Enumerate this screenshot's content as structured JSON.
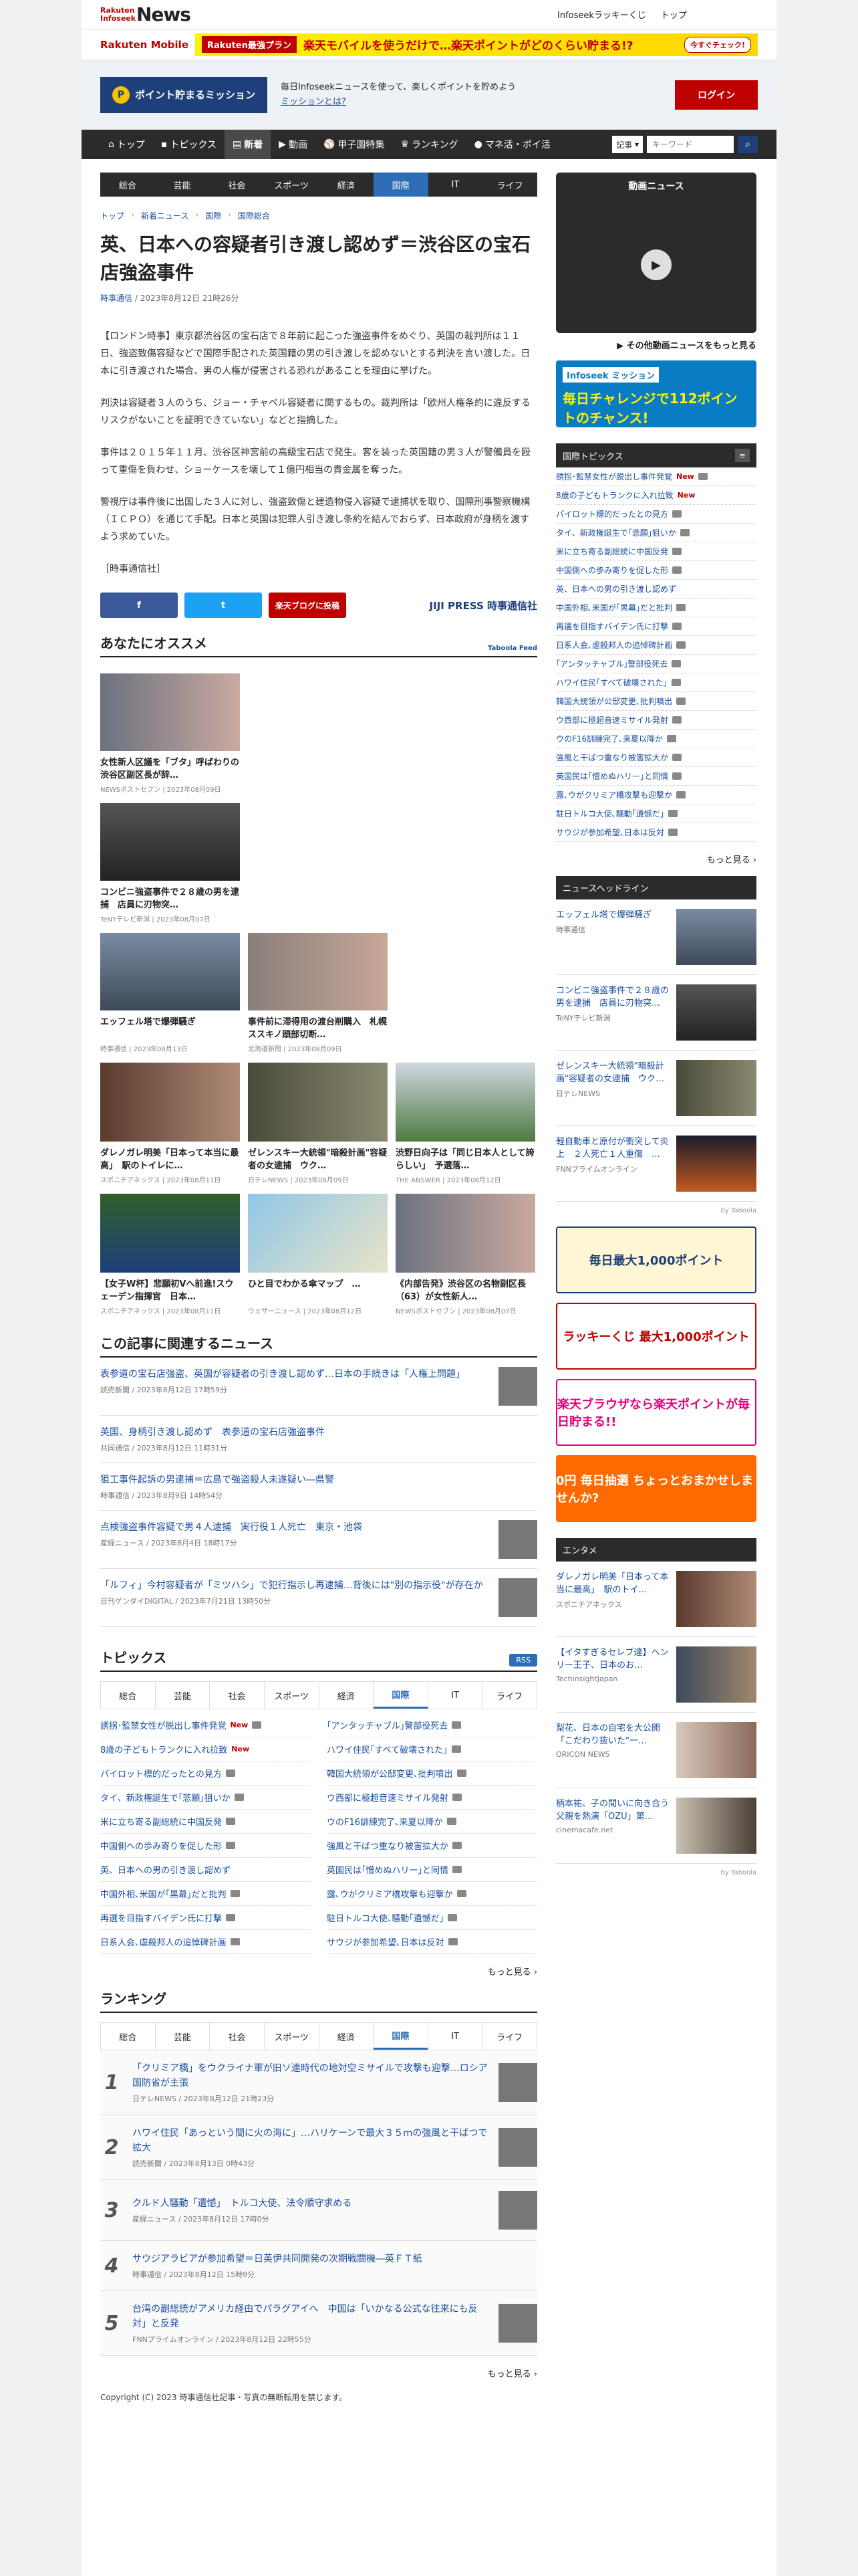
{
  "header": {
    "logo_top": "Rakuten Infoseek",
    "logo_main": "News",
    "kuji": "Infoseekラッキーくじ",
    "top_link": "トップ"
  },
  "promo": {
    "rakuten_mobile": "Rakuten Mobile",
    "plan": "Rakuten最強プラン",
    "text": "楽天モバイルを使うだけで…楽天ポイントがどのくらい貯まる!?",
    "btn": "今すぐチェック!"
  },
  "mission": {
    "label": "ポイント貯まるミッション",
    "desc": "毎日Infoseekニュースを使って、楽しくポイントを貯めよう",
    "link": "ミッションとは?",
    "login": "ログイン"
  },
  "nav": {
    "items": [
      "トップ",
      "トピックス",
      "新着",
      "動画",
      "甲子園特集",
      "ランキング",
      "マネ活・ポイ活"
    ],
    "search_select": "記事",
    "search_placeholder": "キーワード"
  },
  "subnav": [
    "総合",
    "芸能",
    "社会",
    "スポーツ",
    "経済",
    "国際",
    "IT",
    "ライフ"
  ],
  "breadcrumb": [
    "トップ",
    "新着ニュース",
    "国際",
    "国際総合"
  ],
  "article": {
    "title": "英、日本への容疑者引き渡し認めず＝渋谷区の宝石店強盗事件",
    "source": "時事通信",
    "date": "2023年8月12日 21時26分",
    "paragraphs": [
      "【ロンドン時事】東京都渋谷区の宝石店で８年前に起こった強盗事件をめぐり、英国の裁判所は１１日、強盗致傷容疑などで国際手配された英国籍の男の引き渡しを認めないとする判決を言い渡した。日本に引き渡された場合、男の人権が侵害される恐れがあることを理由に挙げた。",
      "判決は容疑者３人のうち、ジョー・チャペル容疑者に関するもの。裁判所は「欧州人権条約に違反するリスクがないことを証明できていない」などと指摘した。",
      "事件は２０１５年１１月、渋谷区神宮前の高級宝石店で発生。客を装った英国籍の男３人が警備員を殴って重傷を負わせ、ショーケースを壊して１億円相当の貴金属を奪った。",
      "警視庁は事件後に出国した３人に対し、強盗致傷と建造物侵入容疑で逮捕状を取り、国際刑事警察機構（ＩＣＰＯ）を通じて手配。日本と英国は犯罪人引き渡し条約を結んでおらず、日本政府が身柄を渡すよう求めていた。",
      "［時事通信社］"
    ],
    "share_fb": "f",
    "share_tw": "t",
    "share_blog": "楽天ブログに投稿",
    "jiji": "JIJI PRESS 時事通信社"
  },
  "recommend": {
    "title": "あなたにオススメ",
    "tag": "Taboola Feed",
    "items": [
      {
        "t": "女性新人区議を「ブタ」呼ばわりの渋谷区副区長が辞…",
        "s": "NEWSポストセブン | 2023年08月09日"
      },
      {
        "t": "コンビニ強盗事件で２８歳の男を逮捕　店員に刃物突…",
        "s": "TeNYテレビ新潟 | 2023年08月07日"
      },
      {
        "t": "エッフェル塔で爆弾騒ぎ",
        "s": "時事通信 | 2023年08月13日"
      },
      {
        "t": "事件前に滞得用の渡台削購入　札幌ススキノ頭部切断…",
        "s": "北海道新聞 | 2023年08月09日"
      },
      {
        "t": "ダレノガレ明美「日本って本当に最高」　駅のトイレに…",
        "s": "スポニチアネックス | 2023年08月11日"
      },
      {
        "t": "ゼレンスキー大統領\"暗殺計画\"容疑者の女逮捕　ウク…",
        "s": "日テレNEWS | 2023年08月09日"
      },
      {
        "t": "渋野日向子は「同じ日本人として誇らしい」　予選落…",
        "s": "THE ANSWER | 2023年08月12日"
      },
      {
        "t": "【女子W杯】悲願初Vへ前進!スウェーデン指揮官　日本…",
        "s": "スポニチアネックス | 2023年08月11日"
      },
      {
        "t": "ひと目でわかる傘マップ　…",
        "s": "ウェザーニュース | 2023年08月12日"
      },
      {
        "t": "《内部告発》渋谷区の名物副区長（63）が女性新人…",
        "s": "NEWSポストセブン | 2023年08月07日"
      }
    ]
  },
  "related": {
    "title": "この記事に関連するニュース",
    "items": [
      {
        "t": "表参道の宝石店強盗、英国が容疑者の引き渡し認めず…日本の手続きは「人権上問題」",
        "s": "読売新聞 / 2023年8月12日 17時59分"
      },
      {
        "t": "英国、身柄引き渡し認めず　表参道の宝石店強盗事件",
        "s": "共同通信 / 2023年8月12日 11時31分"
      },
      {
        "t": "狙工事件起訴の男逮捕＝広島で強盗殺人未遂疑い―県警",
        "s": "時事通信 / 2023年8月9日 14時54分"
      },
      {
        "t": "点検強盗事件容疑で男４人逮捕　実行役１人死亡　東京・池袋",
        "s": "産経ニュース / 2023年8月4日 18時17分"
      },
      {
        "t": "「ルフィ」今村容疑者が「ミツハシ」で犯行指示し再逮捕…背後には\"別の指示役\"が存在か",
        "s": "日刊ゲンダイDIGITAL / 2023年7月21日 13時50分"
      }
    ]
  },
  "topics": {
    "title": "トピックス",
    "rss": "RSS",
    "tabs": [
      "総合",
      "芸能",
      "社会",
      "スポーツ",
      "経済",
      "国際",
      "IT",
      "ライフ"
    ],
    "left": [
      "誘拐･監禁女性が脱出し事件発覚",
      "8歳の子どもトランクに入れ拉致",
      "パイロット標的だったとの見方",
      "タイ、新政権誕生で｢悲願｣狙いか",
      "米に立ち寄る副総統に中国反発",
      "中国側への歩み寄りを促した形",
      "英、日本への男の引き渡し認めず",
      "中国外相､米国が｢黒幕｣だと批判",
      "再選を目指すバイデン氏に打撃",
      "日系人会､虐殺邦人の追悼碑計画"
    ],
    "right": [
      "｢アンタッチャブル｣警部役死去",
      "ハワイ住民｢すべて破壊された｣",
      "韓国大統領が公邸変更､批判噴出",
      "ウ西部に極超音速ミサイル発射",
      "ウのF16訓練完了､来夏以降か",
      "強風と干ばつ重なり被害拡大か",
      "英国民は｢憎めぬハリー｣と同情",
      "露､ウがクリミア橋攻撃も迎撃か",
      "駐日トルコ大使､騒動｢遺憾だ｣",
      "サウジが参加希望､日本は反対"
    ],
    "more": "もっと見る"
  },
  "ranking": {
    "title": "ランキング",
    "tabs": [
      "総合",
      "芸能",
      "社会",
      "スポーツ",
      "経済",
      "国際",
      "IT",
      "ライフ"
    ],
    "items": [
      {
        "n": "1",
        "t": "「クリミア橋」をウクライナ軍が旧ソ連時代の地対空ミサイルで攻撃も迎撃…ロシア国防省が主張",
        "s": "日テレNEWS / 2023年8月12日 21時23分"
      },
      {
        "n": "2",
        "t": "ハワイ住民「あっという間に火の海に」…ハリケーンで最大３５ｍの強風と干ばつで拡大",
        "s": "読売新聞 / 2023年8月13日 0時43分"
      },
      {
        "n": "3",
        "t": "クルド人騒動「遺憾」　トルコ大使、法令順守求める",
        "s": "産経ニュース / 2023年8月12日 17時0分"
      },
      {
        "n": "4",
        "t": "サウジアラビアが参加希望＝日英伊共同開発の次期戦闘機―英ＦＴ紙",
        "s": "時事通信 / 2023年8月12日 15時9分"
      },
      {
        "n": "5",
        "t": "台湾の副総統がアメリカ経由でパラグアイへ　中国は「いかなる公式な往来にも反対」と反発",
        "s": "FNNプライムオンライン / 2023年8月12日 22時55分"
      }
    ],
    "more": "もっと見る"
  },
  "copyright": "Copyright (C) 2023 時事通信社記事・写真の無断転用を禁じます。",
  "sidebar": {
    "video_title": "動画ニュース",
    "video_more": "その他動画ニュースをもっと見る",
    "ad_top": "Infoseek ミッション",
    "ad_main": "毎日チャレンジで112ポイントのチャンス!",
    "intl_title": "国際トピックス",
    "intl": [
      "誘拐･監禁女性が脱出し事件発覚",
      "8歳の子どもトランクに入れ拉致",
      "パイロット標的だったとの見方",
      "タイ、新政権誕生で｢悲願｣狙いか",
      "米に立ち寄る副総統に中国反発",
      "中国側への歩み寄りを促した形",
      "英、日本への男の引き渡し認めず",
      "中国外相､米国が｢黒幕｣だと批判",
      "再選を目指すバイデン氏に打撃",
      "日系人会､虐殺邦人の追悼碑計画",
      "｢アンタッチャブル｣警部役死去",
      "ハワイ住民｢すべて破壊された｣",
      "韓国大統領が公邸変更､批判噴出",
      "ウ西部に極超音速ミサイル発射",
      "ウのF16訓練完了､来夏以降か",
      "強風と干ばつ重なり被害拡大か",
      "英国民は｢憎めぬハリー｣と同情",
      "露､ウがクリミア橋攻撃も迎撃か",
      "駐日トルコ大使､騒動｢遺憾だ｣",
      "サウジが参加希望､日本は反対"
    ],
    "intl_more": "もっと見る",
    "headline_title": "ニュースヘッドライン",
    "headlines": [
      {
        "t": "エッフェル塔で爆弾騒ぎ",
        "s": "時事通信"
      },
      {
        "t": "コンビニ強盗事件で２８歳の男を逮捕　店員に刃物突…",
        "s": "TeNYテレビ新潟"
      },
      {
        "t": "ゼレンスキー大統領\"暗殺計画\"容疑者の女逮捕　ウク…",
        "s": "日テレNEWS"
      },
      {
        "t": "軽自動車と原付が衝突して炎上　２人死亡１人重傷　…",
        "s": "FNNプライムオンライン"
      }
    ],
    "ads": [
      "毎日最大1,000ポイント",
      "ラッキーくじ 最大1,000ポイント",
      "楽天ブラウザなら楽天ポイントが毎日貯まる!!",
      "0円 毎日抽選 ちょっとおまかせしませんか?"
    ],
    "ent_title": "エンタメ",
    "ent": [
      {
        "t": "ダレノガレ明美「日本って本当に最高」　駅のトイ…",
        "s": "スポニチアネックス"
      },
      {
        "t": "【イタすぎるセレブ達】ヘンリー王子、日本のお…",
        "s": "TechinsightJapan"
      },
      {
        "t": "梨花、日本の自宅を大公開「こだわり抜いた\"一…",
        "s": "ORICON NEWS"
      },
      {
        "t": "柄本祐、子の間いに向き合う父親を熱演「OZU」第…",
        "s": "cinemacafe.net"
      }
    ],
    "by_taboola": "by Taboola"
  }
}
